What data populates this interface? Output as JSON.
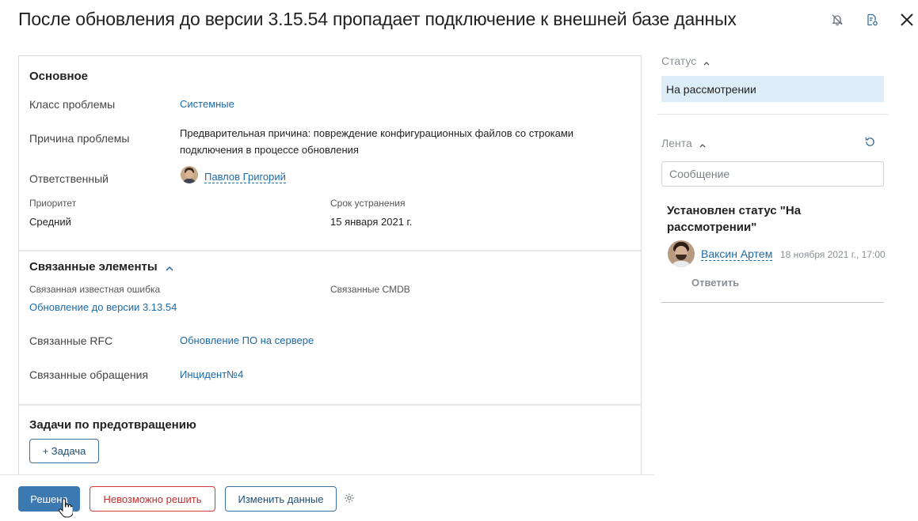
{
  "header": {
    "title": "После обновления до версии 3.15.54 пропадает подключение к внешней базе данных"
  },
  "basic": {
    "title": "Основное",
    "problem_class_label": "Класс проблемы",
    "problem_class_value": "Системные",
    "cause_label": "Причина проблемы",
    "cause_line1": "Предварительная причина: повреждение конфигурационных файлов со строками",
    "cause_line2": "подключения в процессе обновления",
    "responsible_label": "Ответственный",
    "responsible_value": "Павлов Григорий",
    "priority_label": "Приоритет",
    "priority_value": "Средний",
    "deadline_label": "Срок устранения",
    "deadline_value": "15 января 2021 г."
  },
  "related": {
    "title": "Связанные элементы",
    "known_error_label": "Связанная известная ошибка",
    "known_error_value": "Обновление до версии 3.13.54",
    "cmdb_label": "Связанные CMDB",
    "rfc_label": "Связанные RFC",
    "rfc_value": "Обновление ПО на сервере",
    "requests_label": "Связанные обращения",
    "requests_value": "Инцидент№4"
  },
  "tasks": {
    "title": "Задачи по предотвращению",
    "add_button": "+ Задача"
  },
  "footer": {
    "solved_button": "Решена",
    "cannot_solve_button": "Невозможно решить",
    "edit_button": "Изменить данные"
  },
  "sidebar": {
    "status_label": "Статус",
    "status_value": "На рассмотрении",
    "feed_label": "Лента",
    "message_placeholder": "Сообщение",
    "feed_item_text_line1": "Установлен статус \"На",
    "feed_item_text_line2": "рассмотрении\"",
    "feed_item_author": "Ваксин Артем",
    "feed_item_time": "18 ноября 2021 г., 17:00",
    "reply_label": "Ответить"
  },
  "colors": {
    "accent": "#3b79b0",
    "link": "#1e6aa8",
    "danger": "#d63a3a",
    "status_bg": "#dcedf8"
  }
}
